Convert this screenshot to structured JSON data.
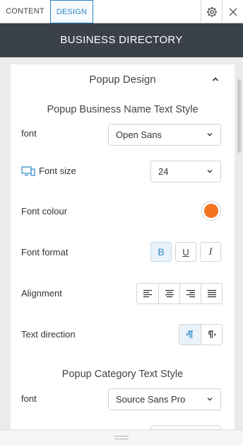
{
  "tabs": {
    "content": "CONTENT",
    "design": "DESIGN"
  },
  "header": {
    "title": "BUSINESS DIRECTORY"
  },
  "section": {
    "title": "Popup Design"
  },
  "business_name_style": {
    "heading": "Popup Business Name Text Style",
    "font_label": "font",
    "font_value": "Open Sans",
    "font_size_label": "Font size",
    "font_size_value": "24",
    "font_colour_label": "Font colour",
    "font_colour": "#f47321",
    "font_format_label": "Font format",
    "format_bold": "B",
    "format_underline": "U",
    "format_italic": "I",
    "alignment_label": "Alignment",
    "text_direction_label": "Text direction"
  },
  "category_style": {
    "heading": "Popup Category Text Style",
    "font_label": "font",
    "font_value": "Source Sans Pro"
  },
  "icons": {
    "settings": "gear-icon",
    "close": "close-icon",
    "collapse": "chevron-up-icon",
    "dropdown": "chevron-down-icon",
    "device": "devices-icon"
  },
  "colors": {
    "accent": "#2b86c5",
    "header_bg": "#3a4149"
  }
}
